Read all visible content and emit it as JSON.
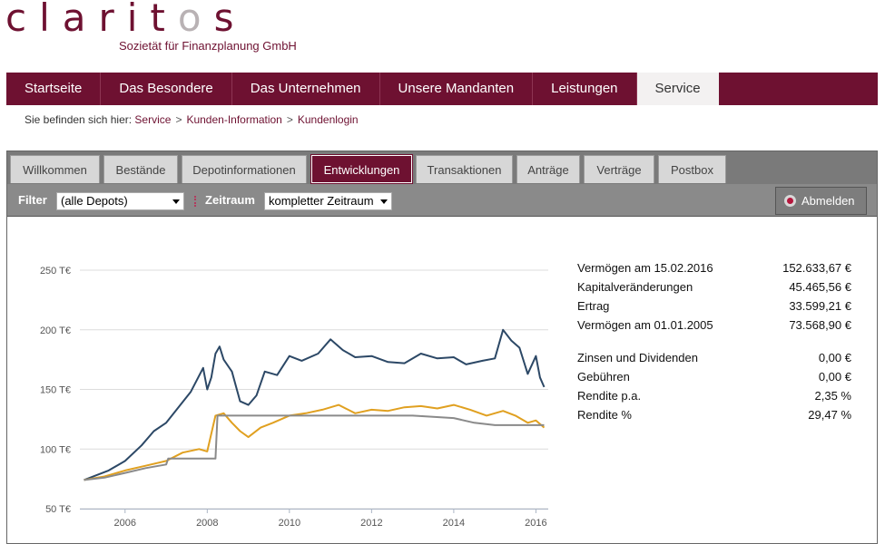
{
  "logo": {
    "text_pre": "clarit",
    "text_o": "o",
    "text_post": "s",
    "subtitle": "Sozietät für Finanzplanung GmbH"
  },
  "nav": {
    "items": [
      {
        "label": "Startseite"
      },
      {
        "label": "Das Besondere"
      },
      {
        "label": "Das Unternehmen"
      },
      {
        "label": "Unsere Mandanten"
      },
      {
        "label": "Leistungen"
      },
      {
        "label": "Service"
      }
    ],
    "active": "Service"
  },
  "breadcrumb": {
    "prefix": "Sie befinden sich hier:",
    "items": [
      "Service",
      "Kunden-Information",
      "Kundenlogin"
    ]
  },
  "tabs": {
    "items": [
      "Willkommen",
      "Bestände",
      "Depotinformationen",
      "Entwicklungen",
      "Transaktionen",
      "Anträge",
      "Verträge",
      "Postbox"
    ],
    "active": "Entwicklungen"
  },
  "filter": {
    "label": "Filter",
    "value": "(alle Depots)",
    "period_label": "Zeitraum",
    "period_value": "kompletter Zeitraum",
    "logout_label": "Abmelden"
  },
  "stats": [
    {
      "label": "Vermögen am 15.02.2016",
      "value": "152.633,67 €"
    },
    {
      "label": "Kapitalveränderungen",
      "value": "45.465,56 €"
    },
    {
      "label": "Ertrag",
      "value": "33.599,21 €"
    },
    {
      "label": "Vermögen am 01.01.2005",
      "value": "73.568,90 €"
    },
    {
      "label": "Zinsen und Dividenden",
      "value": "0,00 €"
    },
    {
      "label": "Gebühren",
      "value": "0,00 €"
    },
    {
      "label": "Rendite p.a.",
      "value": "2,35 %"
    },
    {
      "label": "Rendite %",
      "value": "29,47 %"
    }
  ],
  "colors": {
    "brand": "#6e1131",
    "series_navy": "#2c4866",
    "series_orange": "#e0a020",
    "series_gray": "#8a8a8a"
  },
  "chart_data": {
    "type": "line",
    "xlim": [
      2004.9,
      2016.3
    ],
    "ylim": [
      50,
      250
    ],
    "y_ticks": [
      50,
      100,
      150,
      200,
      250
    ],
    "y_tick_labels": [
      "50 T€",
      "100 T€",
      "150 T€",
      "200 T€",
      "250 T€"
    ],
    "x_ticks": [
      2006,
      2008,
      2010,
      2012,
      2014,
      2016
    ],
    "x_tick_labels": [
      "2006",
      "2008",
      "2010",
      "2012",
      "2014",
      "2016"
    ],
    "grid": true,
    "series": [
      {
        "color": "#2c4866",
        "x": [
          2005.0,
          2005.3,
          2005.6,
          2006.0,
          2006.4,
          2006.7,
          2007.0,
          2007.3,
          2007.6,
          2007.9,
          2008.0,
          2008.1,
          2008.2,
          2008.3,
          2008.4,
          2008.6,
          2008.8,
          2009.0,
          2009.2,
          2009.4,
          2009.7,
          2010.0,
          2010.3,
          2010.7,
          2011.0,
          2011.3,
          2011.6,
          2012.0,
          2012.4,
          2012.8,
          2013.2,
          2013.6,
          2014.0,
          2014.3,
          2014.7,
          2015.0,
          2015.2,
          2015.4,
          2015.6,
          2015.8,
          2016.0,
          2016.1,
          2016.2
        ],
        "y": [
          74,
          78,
          82,
          90,
          103,
          115,
          122,
          135,
          148,
          168,
          150,
          160,
          180,
          186,
          175,
          165,
          140,
          137,
          145,
          165,
          162,
          178,
          174,
          180,
          192,
          183,
          177,
          178,
          173,
          172,
          180,
          176,
          177,
          171,
          174,
          176,
          200,
          191,
          185,
          163,
          178,
          160,
          152
        ]
      },
      {
        "color": "#e0a020",
        "x": [
          2005.0,
          2005.5,
          2006.0,
          2006.5,
          2007.0,
          2007.4,
          2007.8,
          2008.0,
          2008.2,
          2008.4,
          2008.6,
          2008.8,
          2009.0,
          2009.3,
          2009.6,
          2010.0,
          2010.4,
          2010.8,
          2011.2,
          2011.6,
          2012.0,
          2012.4,
          2012.8,
          2013.2,
          2013.6,
          2014.0,
          2014.4,
          2014.8,
          2015.2,
          2015.5,
          2015.8,
          2016.0,
          2016.2
        ],
        "y": [
          74,
          77,
          82,
          86,
          90,
          97,
          100,
          98,
          128,
          130,
          122,
          115,
          110,
          118,
          122,
          128,
          130,
          133,
          137,
          130,
          133,
          132,
          135,
          136,
          134,
          137,
          133,
          128,
          132,
          128,
          122,
          124,
          118
        ]
      },
      {
        "color": "#8a8a8a",
        "x": [
          2005.0,
          2005.5,
          2006.0,
          2006.5,
          2007.0,
          2007.05,
          2007.5,
          2008.0,
          2008.2,
          2008.25,
          2009.0,
          2010.0,
          2011.0,
          2012.0,
          2013.0,
          2013.5,
          2014.0,
          2014.5,
          2015.0,
          2015.5,
          2016.0,
          2016.2
        ],
        "y": [
          74,
          76,
          80,
          84,
          87,
          92,
          92,
          92,
          92,
          128,
          128,
          128,
          128,
          128,
          128,
          127,
          126,
          122,
          120,
          120,
          120,
          120
        ]
      }
    ]
  }
}
